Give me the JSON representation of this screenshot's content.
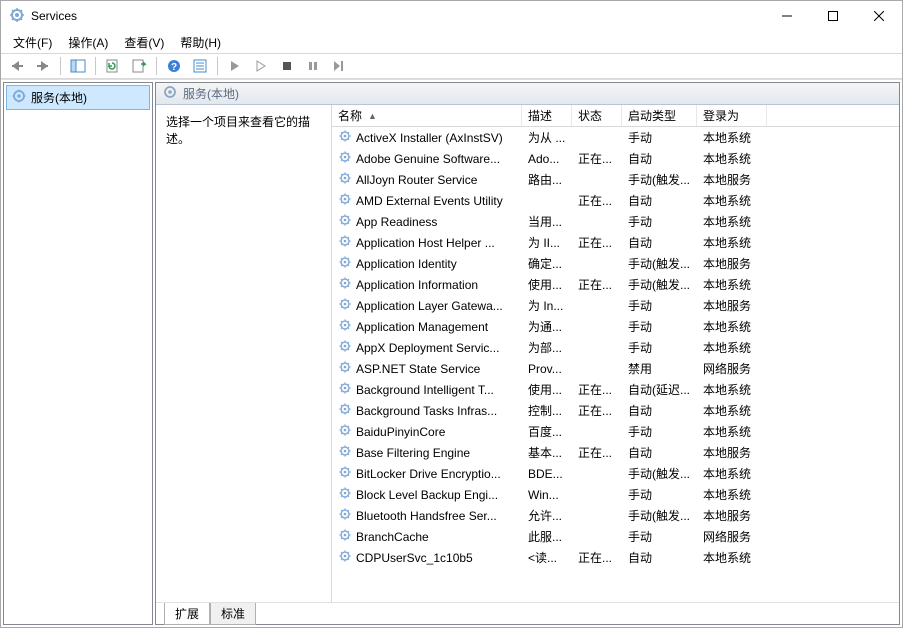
{
  "window": {
    "title": "Services"
  },
  "menus": [
    "文件(F)",
    "操作(A)",
    "查看(V)",
    "帮助(H)"
  ],
  "tree": {
    "root": "服务(本地)"
  },
  "panel": {
    "title": "服务(本地)"
  },
  "detail": {
    "prompt": "选择一个项目来查看它的描述。"
  },
  "columns": {
    "name": "名称",
    "desc": "描述",
    "status": "状态",
    "start": "启动类型",
    "logon": "登录为"
  },
  "services": [
    {
      "name": "ActiveX Installer (AxInstSV)",
      "desc": "为从 ...",
      "status": "",
      "start": "手动",
      "logon": "本地系统"
    },
    {
      "name": "Adobe Genuine Software...",
      "desc": "Ado...",
      "status": "正在...",
      "start": "自动",
      "logon": "本地系统"
    },
    {
      "name": "AllJoyn Router Service",
      "desc": "路由...",
      "status": "",
      "start": "手动(触发...",
      "logon": "本地服务"
    },
    {
      "name": "AMD External Events Utility",
      "desc": "",
      "status": "正在...",
      "start": "自动",
      "logon": "本地系统"
    },
    {
      "name": "App Readiness",
      "desc": "当用...",
      "status": "",
      "start": "手动",
      "logon": "本地系统"
    },
    {
      "name": "Application Host Helper ...",
      "desc": "为 II...",
      "status": "正在...",
      "start": "自动",
      "logon": "本地系统"
    },
    {
      "name": "Application Identity",
      "desc": "确定...",
      "status": "",
      "start": "手动(触发...",
      "logon": "本地服务"
    },
    {
      "name": "Application Information",
      "desc": "使用...",
      "status": "正在...",
      "start": "手动(触发...",
      "logon": "本地系统"
    },
    {
      "name": "Application Layer Gatewa...",
      "desc": "为 In...",
      "status": "",
      "start": "手动",
      "logon": "本地服务"
    },
    {
      "name": "Application Management",
      "desc": "为通...",
      "status": "",
      "start": "手动",
      "logon": "本地系统"
    },
    {
      "name": "AppX Deployment Servic...",
      "desc": "为部...",
      "status": "",
      "start": "手动",
      "logon": "本地系统"
    },
    {
      "name": "ASP.NET State Service",
      "desc": "Prov...",
      "status": "",
      "start": "禁用",
      "logon": "网络服务"
    },
    {
      "name": "Background Intelligent T...",
      "desc": "使用...",
      "status": "正在...",
      "start": "自动(延迟...",
      "logon": "本地系统"
    },
    {
      "name": "Background Tasks Infras...",
      "desc": "控制...",
      "status": "正在...",
      "start": "自动",
      "logon": "本地系统"
    },
    {
      "name": "BaiduPinyinCore",
      "desc": "百度...",
      "status": "",
      "start": "手动",
      "logon": "本地系统"
    },
    {
      "name": "Base Filtering Engine",
      "desc": "基本...",
      "status": "正在...",
      "start": "自动",
      "logon": "本地服务"
    },
    {
      "name": "BitLocker Drive Encryptio...",
      "desc": "BDE...",
      "status": "",
      "start": "手动(触发...",
      "logon": "本地系统"
    },
    {
      "name": "Block Level Backup Engi...",
      "desc": "Win...",
      "status": "",
      "start": "手动",
      "logon": "本地系统"
    },
    {
      "name": "Bluetooth Handsfree Ser...",
      "desc": "允许...",
      "status": "",
      "start": "手动(触发...",
      "logon": "本地服务"
    },
    {
      "name": "BranchCache",
      "desc": "此服...",
      "status": "",
      "start": "手动",
      "logon": "网络服务"
    },
    {
      "name": "CDPUserSvc_1c10b5",
      "desc": "<读...",
      "status": "正在...",
      "start": "自动",
      "logon": "本地系统"
    }
  ],
  "tabs": {
    "extended": "扩展",
    "standard": "标准"
  },
  "sort_indicator": "▲"
}
